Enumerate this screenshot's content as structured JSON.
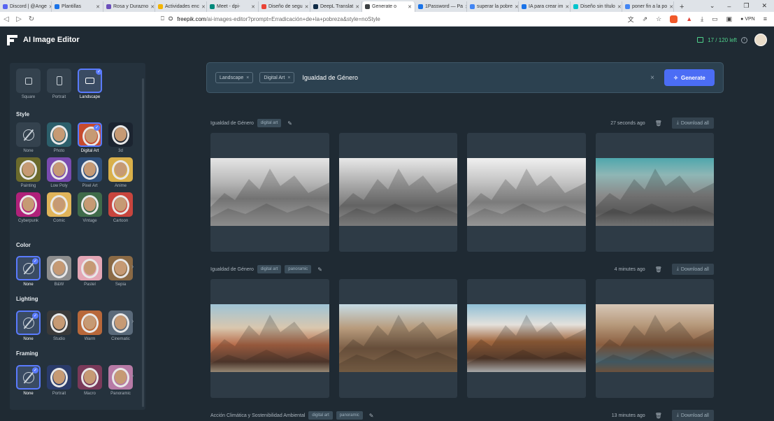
{
  "browser": {
    "tabs": [
      {
        "label": "Discord | @Ange",
        "color": "#5865f2",
        "active": false
      },
      {
        "label": "Plantillas",
        "color": "#1a73e8",
        "active": false
      },
      {
        "label": "Rosa y Durazno",
        "color": "#6b4fbb",
        "active": false
      },
      {
        "label": "Actividades enc",
        "color": "#f4b400",
        "active": false
      },
      {
        "label": "Meet - dpi-",
        "color": "#00897b",
        "active": false
      },
      {
        "label": "Diseño de segu",
        "color": "#ea4335",
        "active": false
      },
      {
        "label": "DeepL Translat",
        "color": "#0f2b46",
        "active": false
      },
      {
        "label": "Generate o",
        "color": "#3c4043",
        "active": true
      },
      {
        "label": "1Password — Pa",
        "color": "#1a73e8",
        "active": false
      },
      {
        "label": "superar la pobre",
        "color": "#4285f4",
        "active": false
      },
      {
        "label": "IA para crear im",
        "color": "#1a73e8",
        "active": false
      },
      {
        "label": "Diseño sin título",
        "color": "#00c4cc",
        "active": false
      },
      {
        "label": "poner fin a la po",
        "color": "#4285f4",
        "active": false
      }
    ],
    "new_tab": "+",
    "url_host": "freepik.com",
    "url_path": "/ai-images-editor?prompt=Erradicación+de+la+pobreza&style=noStyle",
    "vpn_label": "VPN",
    "win_controls": [
      "⌄",
      "–",
      "❐",
      "✕"
    ]
  },
  "app": {
    "title": "AI Image Editor",
    "credits": "17 / 120 left",
    "info": "i"
  },
  "sidebar": {
    "ratios": [
      {
        "label": "Square",
        "selected": false
      },
      {
        "label": "Portrait",
        "selected": false
      },
      {
        "label": "Landscape",
        "selected": true
      }
    ],
    "style_title": "Style",
    "styles": [
      {
        "label": "None",
        "kind": "none",
        "selected": false,
        "bg": "#34424e"
      },
      {
        "label": "Photo",
        "kind": "astro",
        "selected": false,
        "bg": "#2c5f6b"
      },
      {
        "label": "Digital Art",
        "kind": "astro",
        "selected": true,
        "bg": "#c74b2f"
      },
      {
        "label": "3d",
        "kind": "astro",
        "selected": false,
        "bg": "#1b2430"
      },
      {
        "label": "Painting",
        "kind": "astro",
        "selected": false,
        "bg": "#6b6a2c"
      },
      {
        "label": "Low Poly",
        "kind": "astro",
        "selected": false,
        "bg": "#7a4bb0"
      },
      {
        "label": "Pixel Art",
        "kind": "astro",
        "selected": false,
        "bg": "#2f4f7a"
      },
      {
        "label": "Anime",
        "kind": "astro",
        "selected": false,
        "bg": "#d9b04a"
      },
      {
        "label": "Cyberpunk",
        "kind": "astro",
        "selected": false,
        "bg": "#b0217a"
      },
      {
        "label": "Comic",
        "kind": "astro",
        "selected": false,
        "bg": "#e0b45a"
      },
      {
        "label": "Vintage",
        "kind": "astro",
        "selected": false,
        "bg": "#3f6b4a"
      },
      {
        "label": "Cartoon",
        "kind": "astro",
        "selected": false,
        "bg": "#c8453e"
      }
    ],
    "color_title": "Color",
    "colors": [
      {
        "label": "None",
        "kind": "none",
        "selected": true,
        "bg": "#3a4b63"
      },
      {
        "label": "B&W",
        "kind": "astro",
        "selected": false,
        "bg": "#8d8d8d"
      },
      {
        "label": "Pastel",
        "kind": "astro",
        "selected": false,
        "bg": "#e3a6b5"
      },
      {
        "label": "Sepia",
        "kind": "astro",
        "selected": false,
        "bg": "#8b6a45"
      }
    ],
    "lighting_title": "Lighting",
    "lightings": [
      {
        "label": "None",
        "kind": "none",
        "selected": true,
        "bg": "#3a4b63"
      },
      {
        "label": "Studio",
        "kind": "astro",
        "selected": false,
        "bg": "#3a3a3a"
      },
      {
        "label": "Warm",
        "kind": "astro",
        "selected": false,
        "bg": "#b8683a"
      },
      {
        "label": "Cinematic",
        "kind": "astro",
        "selected": false,
        "bg": "#5a6a7a"
      }
    ],
    "framing_title": "Framing",
    "framings": [
      {
        "label": "None",
        "kind": "none",
        "selected": true,
        "bg": "#3a4b63"
      },
      {
        "label": "Portrait",
        "kind": "astro",
        "selected": false,
        "bg": "#2a3b6a"
      },
      {
        "label": "Macro",
        "kind": "astro",
        "selected": false,
        "bg": "#7a3a5a"
      },
      {
        "label": "Panoramic",
        "kind": "astro",
        "selected": false,
        "bg": "#b77aa6"
      }
    ]
  },
  "prompt": {
    "chips": [
      "Landscape",
      "Digital Art"
    ],
    "chip_close": "×",
    "text": "Igualdad de Género",
    "clear": "×",
    "generate_label": "Generate"
  },
  "batches": [
    {
      "title": "Igualdad de Género",
      "tags": [
        "digital art"
      ],
      "time": "27 seconds ago",
      "download": "Download all",
      "images": [
        "grey1",
        "grey2",
        "grey3",
        "grey4"
      ]
    },
    {
      "title": "Igualdad de Género",
      "tags": [
        "digital art",
        "panoramic"
      ],
      "time": "4 minutes ago",
      "download": "Download all",
      "images": [
        "col1",
        "col2",
        "col3",
        "col4"
      ]
    },
    {
      "title": "Acción Climática y Sostenibilidad Ambiental",
      "tags": [
        "digital art",
        "panoramic"
      ],
      "time": "13 minutes ago",
      "download": "Download all",
      "images": []
    }
  ]
}
